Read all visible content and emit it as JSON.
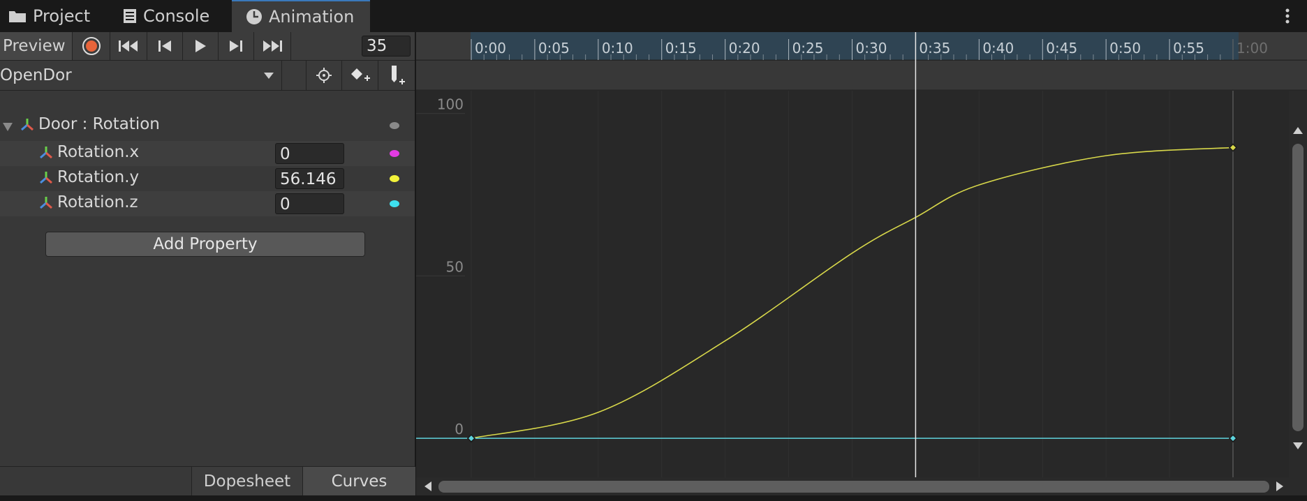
{
  "tabs": [
    {
      "label": "Project",
      "icon": "folder-icon"
    },
    {
      "label": "Console",
      "icon": "console-icon"
    },
    {
      "label": "Animation",
      "icon": "clock-icon",
      "active": true
    }
  ],
  "toolbar": {
    "preview_label": "Preview",
    "frame_value": "35"
  },
  "clip": {
    "name": "OpenDor"
  },
  "properties": {
    "group_label": "Door : Rotation",
    "items": [
      {
        "label": "Rotation.x",
        "value": "0",
        "color": "#e23be2"
      },
      {
        "label": "Rotation.y",
        "value": "56.146",
        "color": "#f2f23a"
      },
      {
        "label": "Rotation.z",
        "value": "0",
        "color": "#3ee0ef"
      }
    ],
    "add_label": "Add Property"
  },
  "view_tabs": {
    "dopesheet": "Dopesheet",
    "curves": "Curves"
  },
  "timeline": {
    "ticks": [
      "0:00",
      "0:05",
      "0:10",
      "0:15",
      "0:20",
      "0:25",
      "0:30",
      "0:35",
      "0:40",
      "0:45",
      "0:50",
      "0:55",
      "1:00"
    ],
    "current_time_label": "0:35"
  },
  "chart_data": {
    "type": "line",
    "x_unit": "seconds",
    "y_ticks": [
      "100",
      "50",
      "0"
    ],
    "ylim": [
      -12,
      107
    ],
    "xlim": [
      0,
      60
    ],
    "current_time": 35,
    "series": [
      {
        "name": "Rotation.y",
        "color": "#d8d84a",
        "x": [
          0,
          10,
          20,
          30,
          35,
          40,
          50,
          60
        ],
        "y": [
          0,
          8,
          30,
          57,
          68,
          78,
          87,
          89.5
        ]
      },
      {
        "name": "Rotation.z",
        "color": "#5fd3dd",
        "x": [
          0,
          60
        ],
        "y": [
          0,
          0
        ]
      }
    ]
  }
}
